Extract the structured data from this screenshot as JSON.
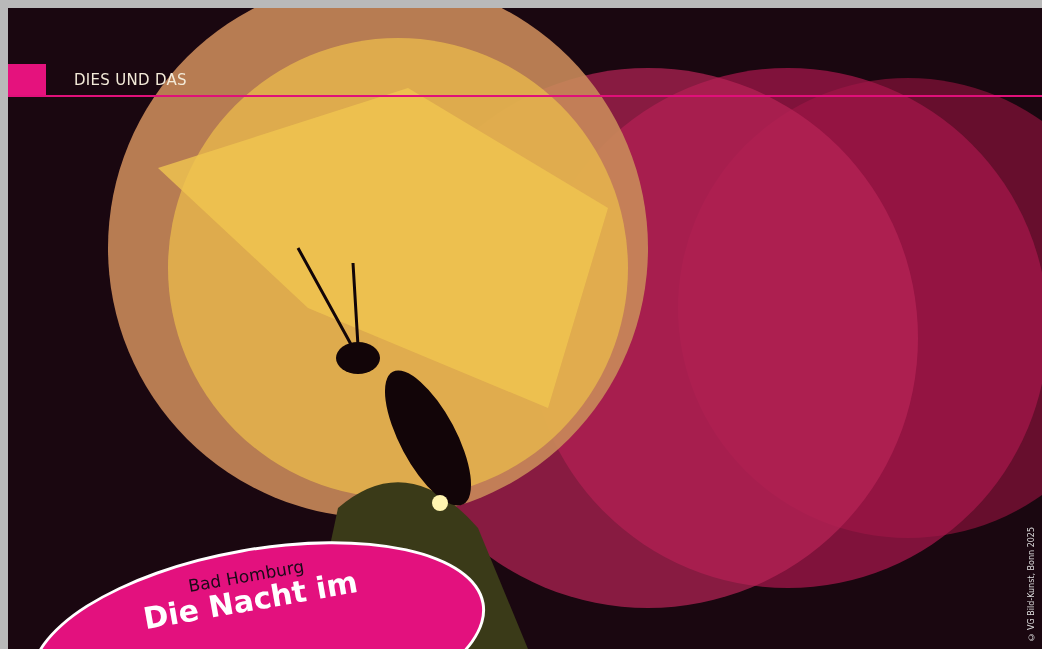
{
  "section_header": {
    "label": "DIES UND DAS"
  },
  "photo": {
    "credit": "© VG Bild-Kunst, Bonn 2025"
  },
  "badge": {
    "location": "Bad Homburg",
    "title": "Die Nacht im"
  }
}
